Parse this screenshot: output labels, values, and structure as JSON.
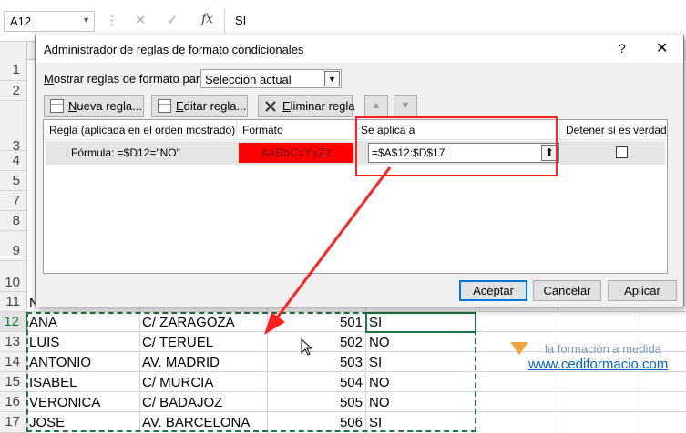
{
  "formula_bar": {
    "name_box": "A12",
    "content": "SI",
    "dots": "⋮",
    "cancel_icon": "✕",
    "enter_icon": "✓",
    "fx_label": "fx"
  },
  "sheet": {
    "visible_rows": [
      {
        "num": "1"
      },
      {
        "num": "2"
      },
      {
        "num": "3"
      },
      {
        "num": "4"
      },
      {
        "num": "5"
      },
      {
        "num": "7"
      },
      {
        "num": "8"
      },
      {
        "num": "9"
      },
      {
        "num": "10"
      },
      {
        "num": "11"
      },
      {
        "num": "12"
      },
      {
        "num": "13"
      },
      {
        "num": "14"
      },
      {
        "num": "15"
      },
      {
        "num": "16"
      },
      {
        "num": "17"
      }
    ],
    "data_rows": [
      {
        "name": "ANA",
        "street": "C/ ZARAGOZA",
        "code": "501",
        "status": "SI"
      },
      {
        "name": "LUIS",
        "street": "C/ TERUEL",
        "code": "502",
        "status": "NO"
      },
      {
        "name": "ANTONIO",
        "street": "AV. MADRID",
        "code": "503",
        "status": "SI"
      },
      {
        "name": "ISABEL",
        "street": "C/ MURCIA",
        "code": "504",
        "status": "NO"
      },
      {
        "name": "VERONICA",
        "street": "C/ BADAJOZ",
        "code": "505",
        "status": "NO"
      },
      {
        "name": "JOSE",
        "street": "AV. BARCELONA",
        "code": "506",
        "status": "SI"
      }
    ],
    "row11_partial": "N",
    "promo_text": "la formación a medida",
    "link": "www.cediformacio.com"
  },
  "dialog": {
    "title": "Administrador de reglas de formato condicionales",
    "help_icon": "?",
    "close_icon": "✕",
    "show_rules_prefix": "M",
    "show_rules_rest": "ostrar reglas de formato para:",
    "show_rules_value": "Selección actual",
    "buttons": {
      "new_rule_u": "N",
      "new_rule_rest": "ueva regla...",
      "edit_rule_u": "E",
      "edit_rule_rest": "ditar regla...",
      "delete_rule_u": "E",
      "delete_rule_rest": "liminar regla",
      "up_arrow": "▲",
      "down_arrow": "▼"
    },
    "columns": {
      "rule": "Regla (aplicada en el orden mostrado)",
      "format": "Formato",
      "applies": "Se aplica a",
      "stop": "Detener si es verdad"
    },
    "rule_row": {
      "formula": "Fórmula: =$D12=\"NO\"",
      "format_preview": "AaBbCcYyZz",
      "applies_to": "=$A$12:$D$17",
      "upload_icon": "⬆"
    },
    "footer": {
      "ok": "Aceptar",
      "cancel": "Cancelar",
      "apply": "Aplicar"
    }
  },
  "colors": {
    "excel_green": "#217346",
    "highlight_red": "#ff2020",
    "format_red": "#ff0000",
    "link_blue": "#0563c1"
  }
}
